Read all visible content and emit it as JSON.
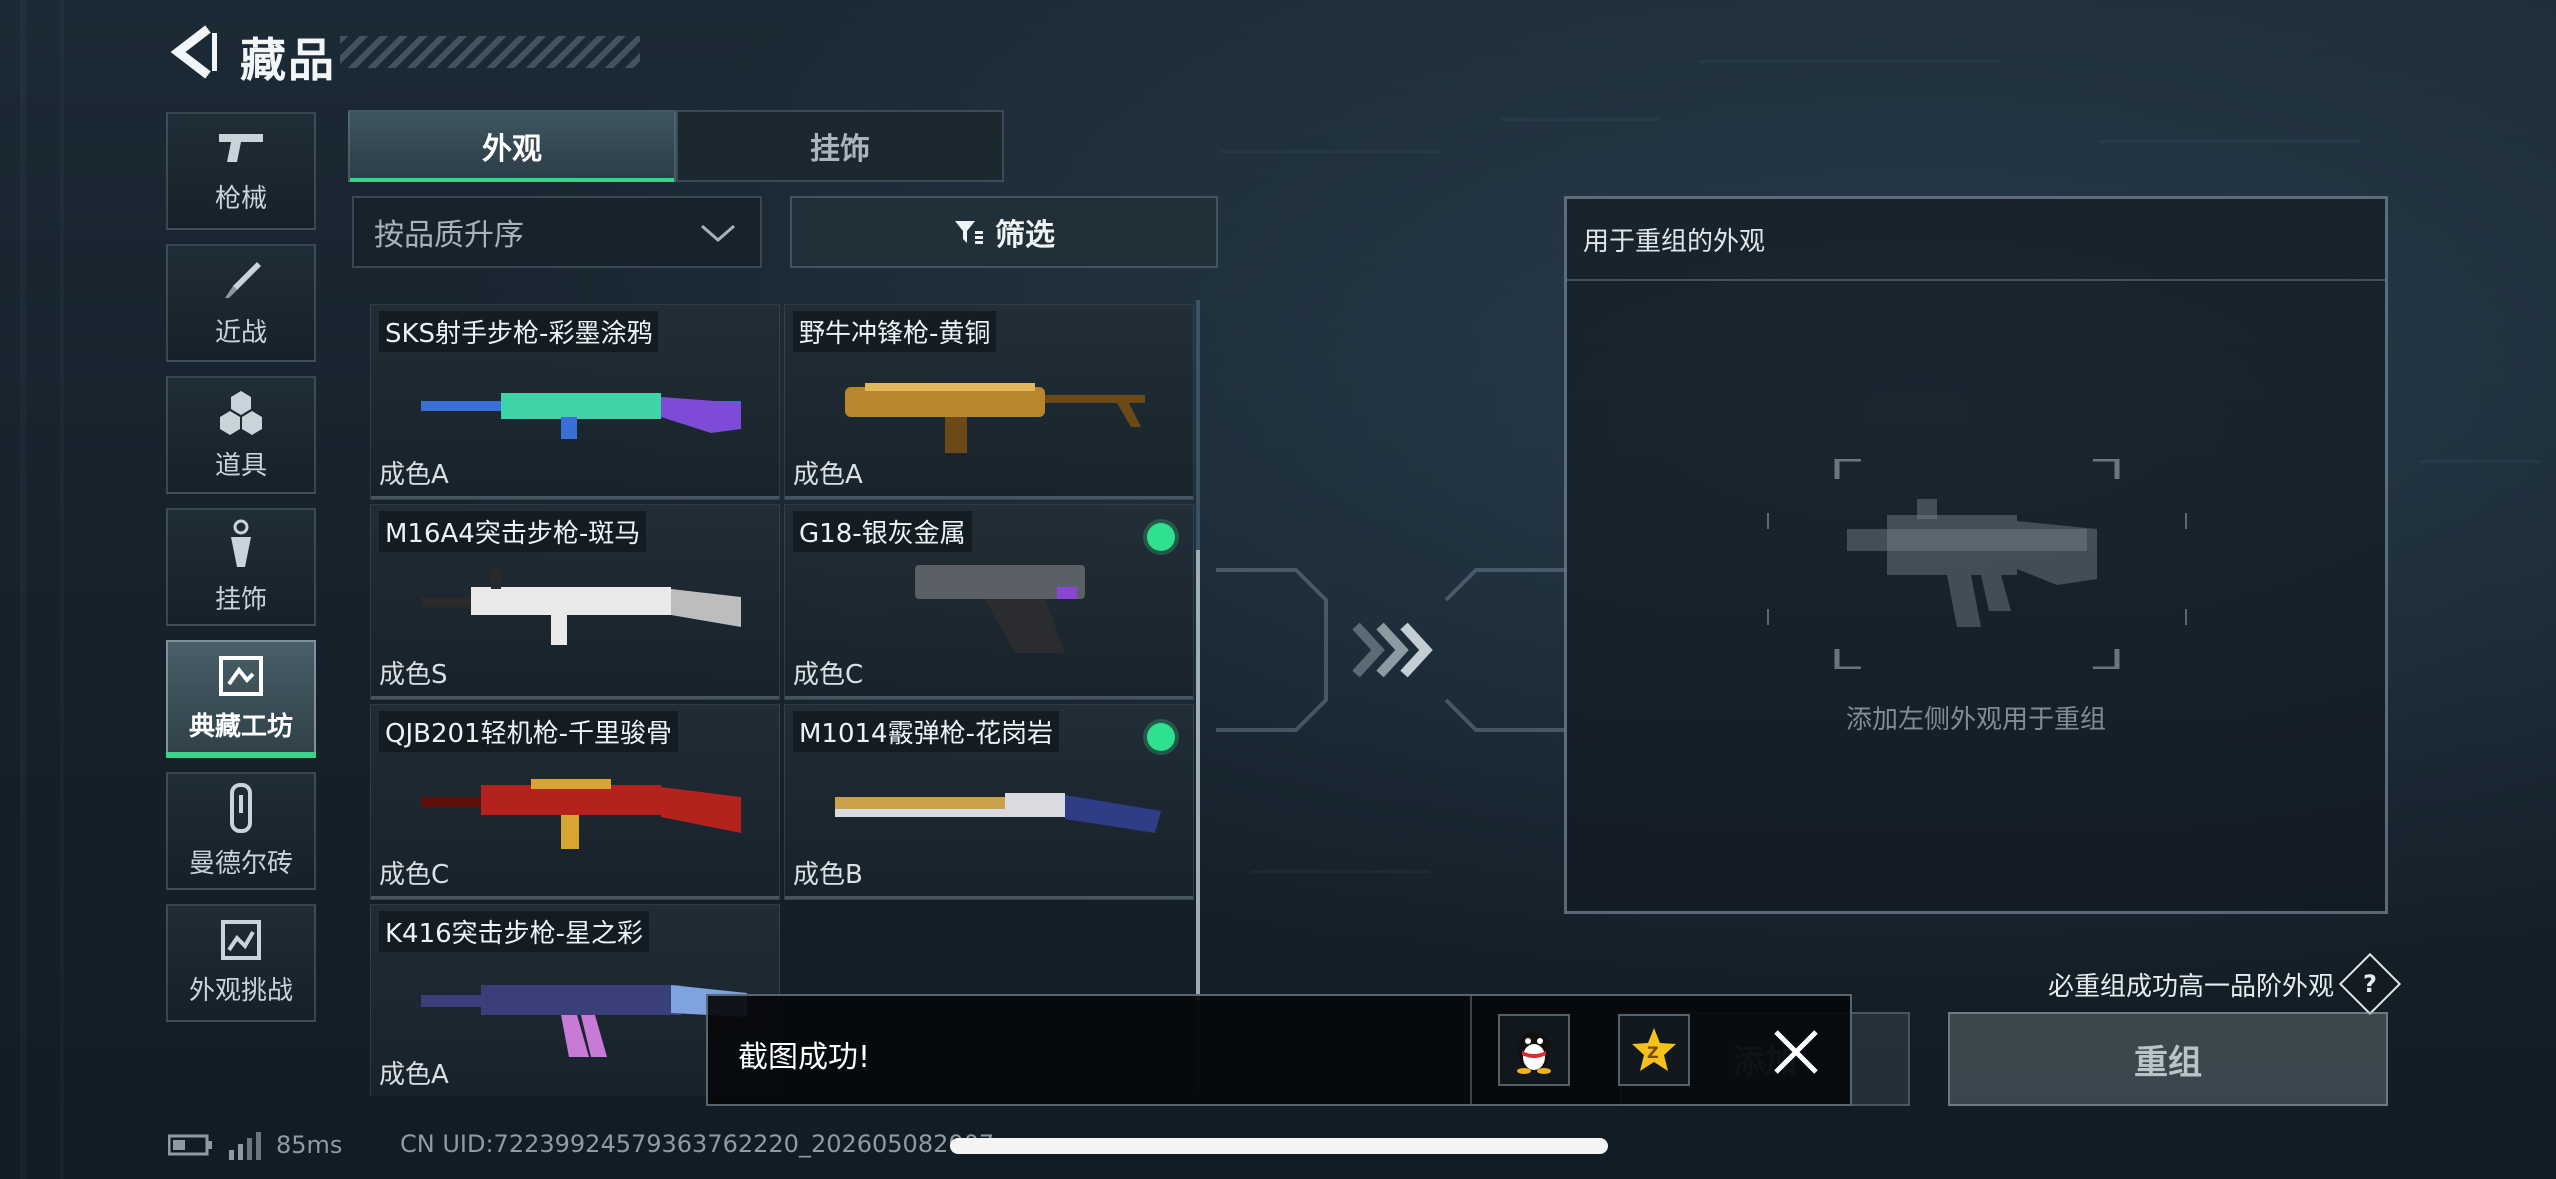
{
  "header": {
    "title": "藏品"
  },
  "nav": [
    {
      "id": "guns",
      "label": "枪械",
      "icon": "pistol-icon",
      "active": false
    },
    {
      "id": "melee",
      "label": "近战",
      "icon": "knife-icon",
      "active": false
    },
    {
      "id": "items",
      "label": "道具",
      "icon": "grenade-icon",
      "active": false
    },
    {
      "id": "charms",
      "label": "挂饰",
      "icon": "charm-icon",
      "active": false
    },
    {
      "id": "workshop",
      "label": "典藏工坊",
      "icon": "workshop-icon",
      "active": true
    },
    {
      "id": "mandel",
      "label": "曼德尔砖",
      "icon": "brick-icon",
      "active": false
    },
    {
      "id": "challenge",
      "label": "外观挑战",
      "icon": "challenge-icon",
      "active": false
    }
  ],
  "tabs": [
    {
      "label": "外观",
      "active": true
    },
    {
      "label": "挂饰",
      "active": false
    }
  ],
  "sort": {
    "label": "按品质升序"
  },
  "filter": {
    "label": "筛选"
  },
  "skins": [
    {
      "name": "SKS射手步枪-彩墨涂鸦",
      "grade": "成色A",
      "selected": false,
      "palette": [
        "#3b6fd8",
        "#3fd4a8",
        "#7d4bd6"
      ]
    },
    {
      "name": "野牛冲锋枪-黄铜",
      "grade": "成色A",
      "selected": false,
      "palette": [
        "#b8862b",
        "#e1b75a",
        "#6b4a18"
      ]
    },
    {
      "name": "M16A4突击步枪-斑马",
      "grade": "成色S",
      "selected": false,
      "palette": [
        "#e9e9e9",
        "#2a2a2a",
        "#bdbdbd"
      ]
    },
    {
      "name": "G18-银灰金属",
      "grade": "成色C",
      "selected": true,
      "palette": [
        "#5b5f66",
        "#2a2c30",
        "#8a45d6"
      ]
    },
    {
      "name": "QJB201轻机枪-千里骏骨",
      "grade": "成色C",
      "selected": false,
      "palette": [
        "#b3221c",
        "#d6a532",
        "#5e0f0c"
      ]
    },
    {
      "name": "M1014霰弹枪-花岗岩",
      "grade": "成色B",
      "selected": true,
      "palette": [
        "#d9dbe0",
        "#2e3d86",
        "#c9a24a"
      ]
    },
    {
      "name": "K416突击步枪-星之彩",
      "grade": "成色A",
      "selected": false,
      "palette": [
        "#3a3f7a",
        "#c77ad6",
        "#7ea3e0"
      ]
    }
  ],
  "recombine_panel": {
    "title": "用于重组的外观",
    "hint": "添加左侧外观用于重组"
  },
  "guarantee_note": "必重组成功高一品阶外观",
  "buttons": {
    "add": "添加",
    "recombine": "重组"
  },
  "toast": {
    "message": "截图成功!"
  },
  "status": {
    "ping": "85ms",
    "uid": "CN UID:7223992457936376222​0_2026050820​07"
  }
}
